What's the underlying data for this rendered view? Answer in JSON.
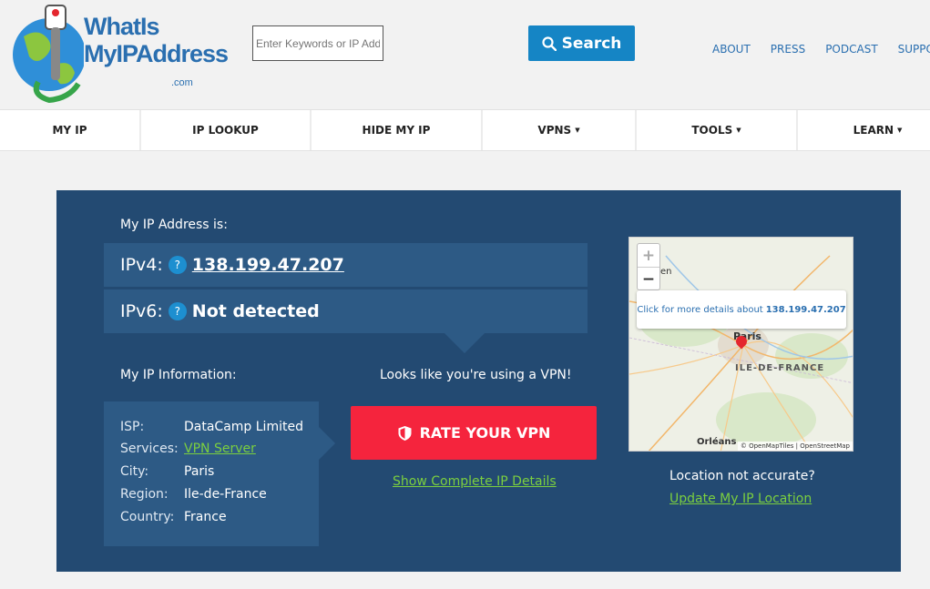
{
  "header": {
    "logo_alt": "WhatIsMyIPAddress.com",
    "logo_line1": "WhatIs",
    "logo_line2": "MyIPAddress",
    "logo_sub": ".com",
    "search_placeholder": "Enter Keywords or IP Address",
    "search_label": "Search",
    "links": [
      "ABOUT",
      "PRESS",
      "PODCAST",
      "SUPPORT"
    ]
  },
  "nav": {
    "items": [
      {
        "label": "MY IP",
        "dropdown": false
      },
      {
        "label": "IP LOOKUP",
        "dropdown": false
      },
      {
        "label": "HIDE MY IP",
        "dropdown": false
      },
      {
        "label": "VPNS",
        "dropdown": true
      },
      {
        "label": "TOOLS",
        "dropdown": true
      },
      {
        "label": "LEARN",
        "dropdown": true
      }
    ]
  },
  "main": {
    "ip_heading": "My IP Address is:",
    "ipv4_label": "IPv4:",
    "ipv4_value": "138.199.47.207",
    "ipv6_label": "IPv6:",
    "ipv6_value": "Not detected",
    "help_glyph": "?",
    "info_heading": "My IP Information:",
    "info": [
      {
        "key": "ISP:",
        "value": "DataCamp Limited"
      },
      {
        "key": "Services:",
        "value": "VPN Server"
      },
      {
        "key": "City:",
        "value": "Paris"
      },
      {
        "key": "Region:",
        "value": "Ile-de-France"
      },
      {
        "key": "Country:",
        "value": "France"
      }
    ],
    "vpn_notice": "Looks like you're using a VPN!",
    "rate_vpn_label": "RATE YOUR VPN",
    "show_details_label": "Show Complete IP Details",
    "location_question": "Location not accurate?",
    "update_location_label": "Update My IP Location"
  },
  "map": {
    "popup_text": "Click for more details about",
    "popup_ip": "138.199.47.207",
    "city_label": "Paris",
    "region_label": "ILE-DE-FRANCE",
    "south_label": "Orléans",
    "west_label": "en",
    "attribution": "© OpenMapTiles | OpenStreetMap",
    "zoom_in": "+",
    "zoom_out": "−"
  },
  "colors": {
    "brand_blue": "#1585c5",
    "panel_bg": "#234a72",
    "row_bg": "#2d5a85",
    "vpn_red": "#f5243d",
    "link_green": "#7bcf3f"
  }
}
